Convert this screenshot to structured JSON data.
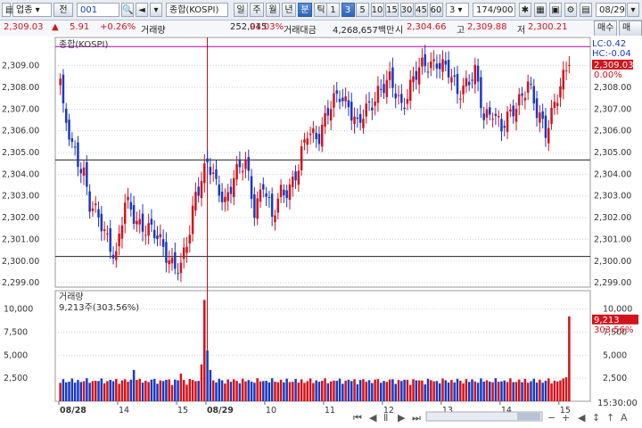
{
  "toolbar": {
    "market_select": "업종",
    "search_icon": "search-icon",
    "jeon_label": "전",
    "code": "001",
    "index_name": "종합(KOSPI)",
    "period_buttons": [
      "일",
      "주",
      "월",
      "년",
      "분",
      "틱"
    ],
    "active_period": "분",
    "minute_buttons": [
      "1",
      "3",
      "5",
      "10",
      "15",
      "30",
      "45",
      "60"
    ],
    "active_minute": "3",
    "count_select": "3",
    "data_count": "174/900",
    "date": "08/29"
  },
  "info_bar": {
    "current_price": "2,309.03",
    "change_arrow": "▲",
    "change": "5.91",
    "change_pct": "+0.26%",
    "volume_label": "거래량",
    "volume": "252,045",
    "volume_ratio": "91.03%",
    "amount_label": "거래대금",
    "amount": "4,268,657백만",
    "open_label": "시",
    "open": "2,304.66",
    "high_label": "고",
    "high": "2,309.88",
    "low_label": "저",
    "low": "2,300.21",
    "buy_button": "매수",
    "sell_button": "매도"
  },
  "price_panel": {
    "title": "종합(KOSPI)",
    "lc": "LC:0.42",
    "hc": "HC:-0.04",
    "last_price_tag": "2,309.03",
    "last_pct": "0.00%",
    "y_ticks": [
      "2,309.00",
      "2,308.00",
      "2,307.00",
      "2,306.00",
      "2,305.00",
      "2,304.00",
      "2,303.00",
      "2,302.00",
      "2,301.00",
      "2,300.00",
      "2,299.00"
    ],
    "y_tick_values": [
      2309,
      2308,
      2307,
      2306,
      2305,
      2304,
      2303,
      2302,
      2301,
      2300,
      2299
    ],
    "ylim": [
      2298.8,
      2310.3
    ],
    "hlines": [
      2309.88,
      2304.66,
      2300.21
    ]
  },
  "volume_panel": {
    "title": "거래량",
    "current": "9,213주(303.56%)",
    "last_tag": "9,213",
    "last_pct": "303.56%",
    "y_ticks": [
      "10,000",
      "7,500",
      "5,000",
      "2,500"
    ],
    "y_tick_values": [
      10000,
      7500,
      5000,
      2500
    ],
    "ylim": [
      0,
      12000
    ]
  },
  "x_axis": {
    "labels": [
      "08/28",
      "14",
      "15",
      "08/29",
      "10",
      "11",
      "12",
      "13",
      "14",
      "15"
    ],
    "label_bars": [
      0,
      20,
      40,
      50,
      70,
      90,
      110,
      130,
      150,
      170
    ],
    "time_label": "15:30:00"
  },
  "colors": {
    "up": "#d3121b",
    "down": "#1a39c2",
    "hline": "#222222",
    "top_line": "#b000b0",
    "cursor": "#c00000"
  },
  "chart_data": {
    "type": "candlestick",
    "anchors": [
      [
        0,
        2308.4
      ],
      [
        1,
        2306.8
      ],
      [
        4,
        2305.2
      ],
      [
        8,
        2304.2
      ],
      [
        10,
        2302.6
      ],
      [
        14,
        2301.6
      ],
      [
        19,
        2300.3
      ],
      [
        22,
        2302.6
      ],
      [
        26,
        2301.9
      ],
      [
        30,
        2301.5
      ],
      [
        34,
        2300.8
      ],
      [
        38,
        2300.0
      ],
      [
        41,
        2299.6
      ],
      [
        44,
        2301.3
      ],
      [
        46,
        2303.2
      ],
      [
        50,
        2304.6
      ],
      [
        53,
        2303.3
      ],
      [
        56,
        2302.8
      ],
      [
        59,
        2304.0
      ],
      [
        63,
        2304.4
      ],
      [
        66,
        2302.4
      ],
      [
        69,
        2303.7
      ],
      [
        72,
        2301.8
      ],
      [
        75,
        2303.2
      ],
      [
        78,
        2303.5
      ],
      [
        81,
        2304.2
      ],
      [
        84,
        2305.9
      ],
      [
        88,
        2305.9
      ],
      [
        91,
        2306.8
      ],
      [
        95,
        2307.7
      ],
      [
        98,
        2307.3
      ],
      [
        101,
        2306.1
      ],
      [
        104,
        2306.9
      ],
      [
        108,
        2307.9
      ],
      [
        112,
        2308.2
      ],
      [
        116,
        2307.2
      ],
      [
        120,
        2308.4
      ],
      [
        124,
        2309.0
      ],
      [
        128,
        2309.3
      ],
      [
        132,
        2308.6
      ],
      [
        135,
        2307.8
      ],
      [
        138,
        2308.3
      ],
      [
        141,
        2308.6
      ],
      [
        144,
        2306.5
      ],
      [
        147,
        2307.1
      ],
      [
        150,
        2306.1
      ],
      [
        153,
        2306.6
      ],
      [
        156,
        2307.5
      ],
      [
        159,
        2308.3
      ],
      [
        162,
        2306.7
      ],
      [
        165,
        2306.0
      ],
      [
        168,
        2307.4
      ],
      [
        171,
        2308.3
      ],
      [
        173,
        2309.03
      ]
    ],
    "volume_baseline": 1700,
    "volume_spikes": [
      [
        25,
        3400
      ],
      [
        41,
        3000
      ],
      [
        48,
        4000
      ],
      [
        49,
        11000
      ],
      [
        50,
        5500
      ],
      [
        51,
        3400
      ],
      [
        172,
        2600
      ],
      [
        173,
        9213
      ]
    ],
    "bar_count": 174
  }
}
